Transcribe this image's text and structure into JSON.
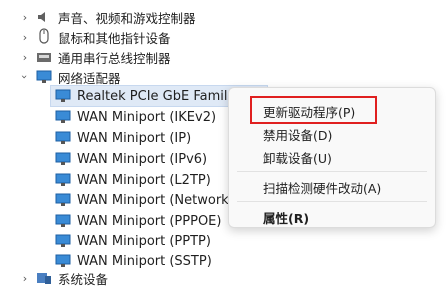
{
  "tree": {
    "categories_top": [
      {
        "label": "声音、视频和游戏控制器",
        "icon": "speaker-icon",
        "expanded": false
      },
      {
        "label": "鼠标和其他指针设备",
        "icon": "mouse-icon",
        "expanded": false
      },
      {
        "label": "通用串行总线控制器",
        "icon": "usb-icon",
        "expanded": false
      },
      {
        "label": "网络适配器",
        "icon": "network-adapter-icon",
        "expanded": true
      }
    ],
    "adapters": [
      {
        "label": "Realtek PCIe GbE Family Controller"
      },
      {
        "label": "WAN Miniport (IKEv2)"
      },
      {
        "label": "WAN Miniport (IP)"
      },
      {
        "label": "WAN Miniport (IPv6)"
      },
      {
        "label": "WAN Miniport (L2TP)"
      },
      {
        "label": "WAN Miniport (Network Monitor)"
      },
      {
        "label": "WAN Miniport (PPPOE)"
      },
      {
        "label": "WAN Miniport (PPTP)"
      },
      {
        "label": "WAN Miniport (SSTP)"
      }
    ],
    "categories_bottom": [
      {
        "label": "系统设备",
        "icon": "system-device-icon",
        "expanded": false
      }
    ]
  },
  "context_menu": {
    "update_driver": "更新驱动程序(P)",
    "disable_device": "禁用设备(D)",
    "uninstall_device": "卸载设备(U)",
    "scan_hardware": "扫描检测硬件改动(A)",
    "properties": "属性(R)"
  },
  "colors": {
    "highlight_box": "#e02020",
    "selection": "#dfe9f6"
  }
}
